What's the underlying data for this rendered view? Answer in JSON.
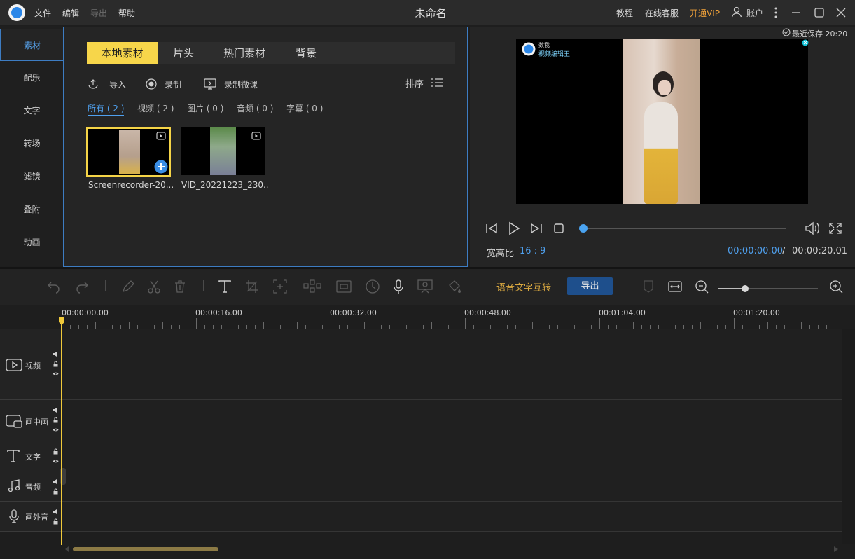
{
  "titlebar": {
    "menu": [
      "文件",
      "编辑",
      "导出",
      "帮助"
    ],
    "title": "未命名",
    "tutorial": "教程",
    "support": "在线客服",
    "vip": "开通VIP",
    "account": "账户"
  },
  "left_tabs": [
    "素材",
    "配乐",
    "文字",
    "转场",
    "滤镜",
    "叠附",
    "动画"
  ],
  "media": {
    "tabs": [
      "本地素材",
      "片头",
      "热门素材",
      "背景"
    ],
    "import_label": "导入",
    "record_label": "录制",
    "record_lesson_label": "录制微课",
    "sort_label": "排序",
    "filters": [
      "所有 ( 2 )",
      "视频 ( 2 )",
      "图片 ( 0 )",
      "音频 ( 0 )",
      "字幕 ( 0 )"
    ],
    "items": [
      {
        "name": "Screenrecorder-20..."
      },
      {
        "name": "VID_20221223_230..."
      }
    ]
  },
  "preview": {
    "autosave": "最近保存 20:20",
    "overlay_line1": "数我",
    "overlay_line2": "视频编辑王",
    "aspect_label": "宽高比",
    "aspect_value": "16 : 9",
    "time_current": "00:00:00.00",
    "time_separator": "/",
    "time_total": "00:00:20.01",
    "progress": 0
  },
  "toolbar": {
    "speech_to_text": "语音文字互转",
    "export": "导出"
  },
  "ruler": [
    "00:00:00.00",
    "00:00:16.00",
    "00:00:32.00",
    "00:00:48.00",
    "00:01:04.00",
    "00:01:20.00"
  ],
  "tracks": [
    "视频",
    "画中画",
    "文字",
    "音频",
    "画外音"
  ],
  "colors": {
    "accent_blue": "#4fa0ee",
    "accent_yellow": "#f7d64a",
    "vip_orange": "#f3a33a"
  }
}
